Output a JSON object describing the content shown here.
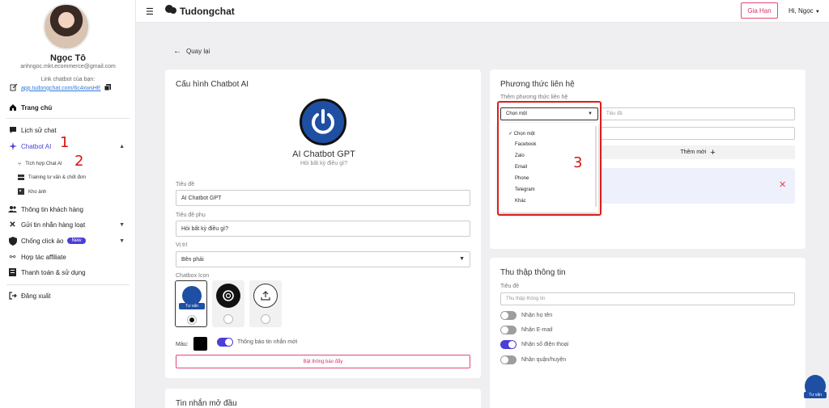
{
  "sidebar": {
    "user_name": "Ngọc Tô",
    "user_email": "anhngoc.mkt.ecommerce@gmail.com",
    "link_label": "Link chatbot của bạn:",
    "link_url": "app.tudongchat.com/6c4xwsHE",
    "nav": {
      "home": "Trang chủ",
      "chat_history": "Lịch sử chat",
      "chatbot_ai": "Chatbot AI",
      "sub_integrate": "Tích hợp Chat AI",
      "sub_training": "Training tư vấn & chốt đơn",
      "sub_images": "Kho ảnh",
      "customers": "Thông tin khách hàng",
      "bulk_send": "Gửi tin nhắn hàng loạt",
      "anti_click": "Chống click ảo",
      "anti_click_badge": "New",
      "affiliate": "Hợp tác affiliate",
      "billing": "Thanh toán & sử dụng",
      "logout": "Đăng xuất"
    },
    "annotations": {
      "a1": "1",
      "a2": "2"
    }
  },
  "topbar": {
    "brand": "Tudongchat",
    "gia_han": "Gia Hạn",
    "greeting": "Hi, Ngọc"
  },
  "content": {
    "back": "Quay lại",
    "config": {
      "title": "Cấu hình Chatbot AI",
      "bot_name": "AI Chatbot GPT",
      "bot_sub": "Hỏi bất kỳ điều gì?",
      "title_label": "Tiêu đề",
      "title_value": "AI Chatbot GPT",
      "subtitle_label": "Tiêu đề phụ",
      "subtitle_value": "Hỏi bất kỳ điều gì?",
      "position_label": "Vị trí",
      "position_value": "Bên phải",
      "icon_label": "Chatbox Icon",
      "icon_tag": "Tư vấn",
      "color_label": "Màu:",
      "notify_label": "Thông báo tin nhắn mới",
      "notify_button": "Bật thông báo đẩy"
    },
    "welcome": {
      "title": "Tin nhắn mở đầu"
    },
    "contact": {
      "title": "Phương thức liên hệ",
      "add_label": "Thêm phương thức liên hệ",
      "select_value": "Chọn một",
      "title_placeholder": "Tiêu đề",
      "add_button": "Thêm mới",
      "options": [
        "Chọn một",
        "Facebook",
        "Zalo",
        "Email",
        "Phone",
        "Telegram",
        "Khác"
      ],
      "annotation": "3"
    },
    "collect": {
      "title": "Thu thập thông tin",
      "title_label": "Tiêu đề",
      "title_placeholder": "Thu thập thông tin",
      "items": [
        {
          "label": "Nhận họ tên",
          "on": false
        },
        {
          "label": "Nhận E-mail",
          "on": false
        },
        {
          "label": "Nhận số điện thoại",
          "on": true
        },
        {
          "label": "Nhận quận/huyện",
          "on": false
        }
      ]
    },
    "float_label": "Tư vấn"
  },
  "colors": {
    "accent": "#4a3fd6",
    "pink": "#d63070",
    "highlight": "#e01b1b",
    "bot_blue": "#1e4fa3"
  }
}
